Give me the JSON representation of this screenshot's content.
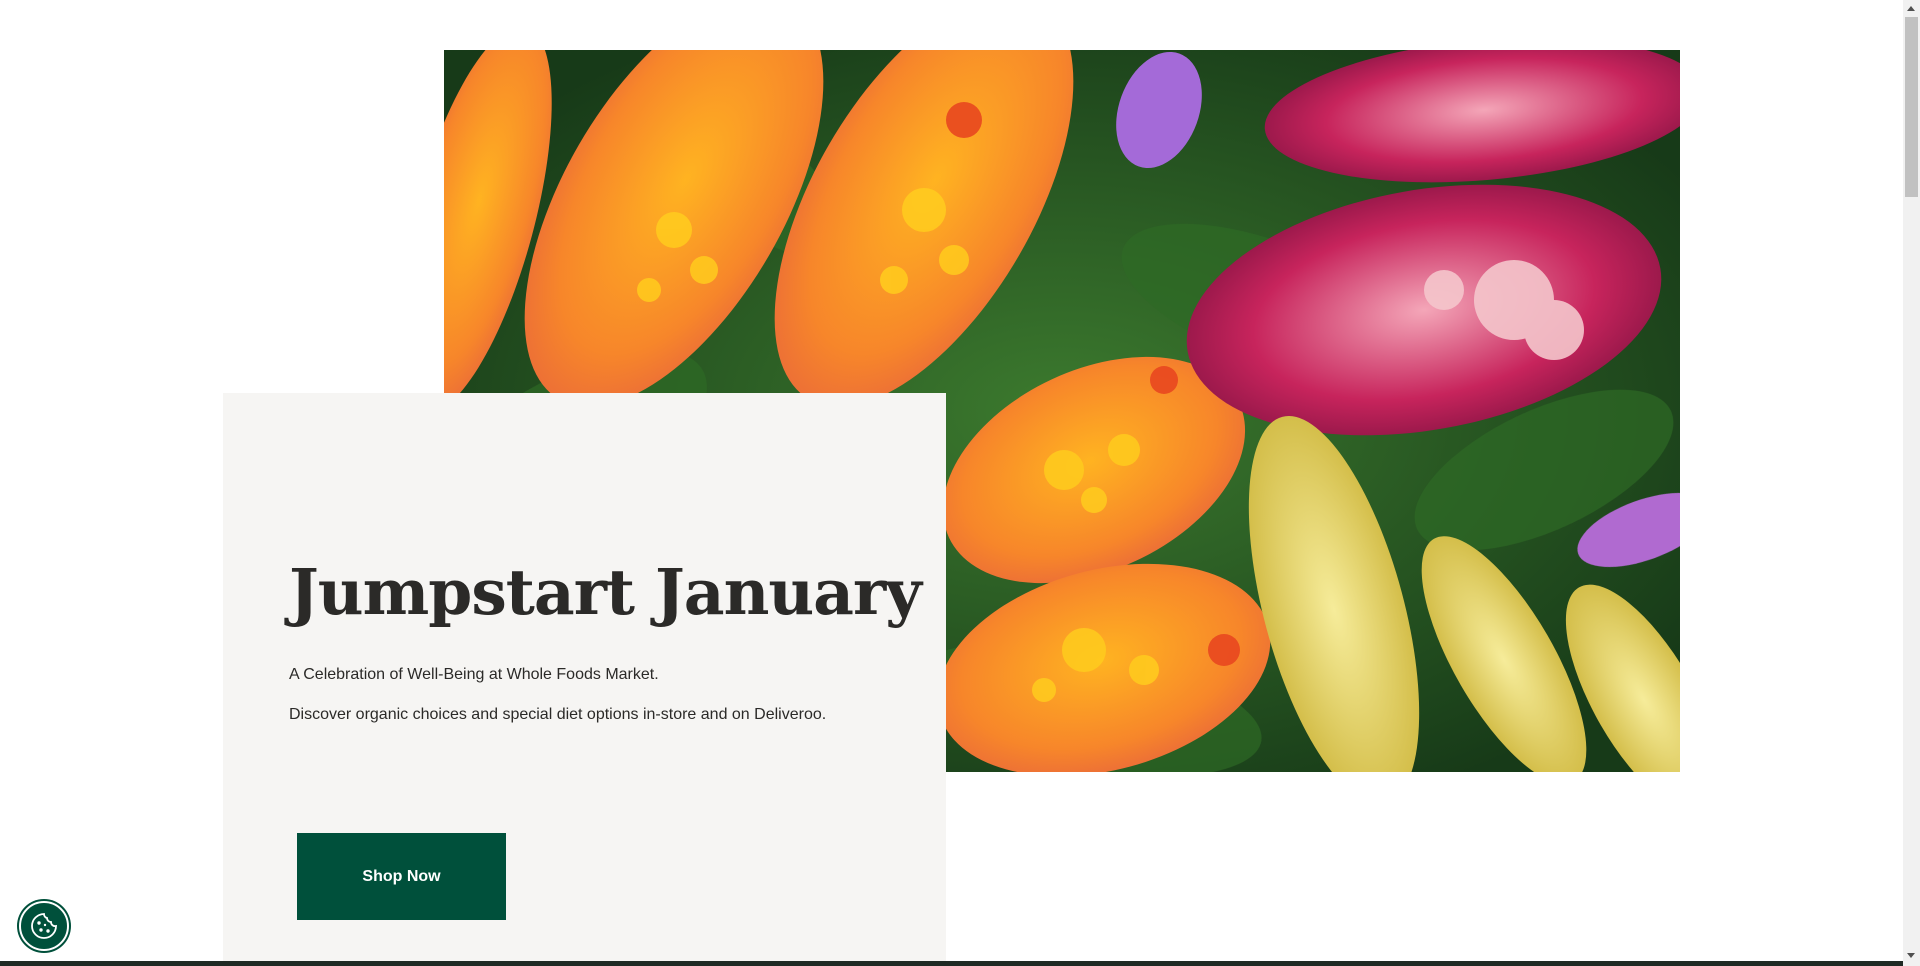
{
  "hero": {
    "image_description_icon": "vegetable-arrangement-image",
    "title": "Jumpstart January",
    "subtitle": "A Celebration of Well-Being at Whole Foods Market.",
    "description": "Discover organic choices and special diet options in-store and on Deliveroo.",
    "cta_label": "Shop Now"
  },
  "cookie": {
    "icon": "cookie-icon"
  },
  "colors": {
    "brand_green": "#00503b",
    "card_bg": "#f6f5f3",
    "text": "#2b2a28"
  }
}
